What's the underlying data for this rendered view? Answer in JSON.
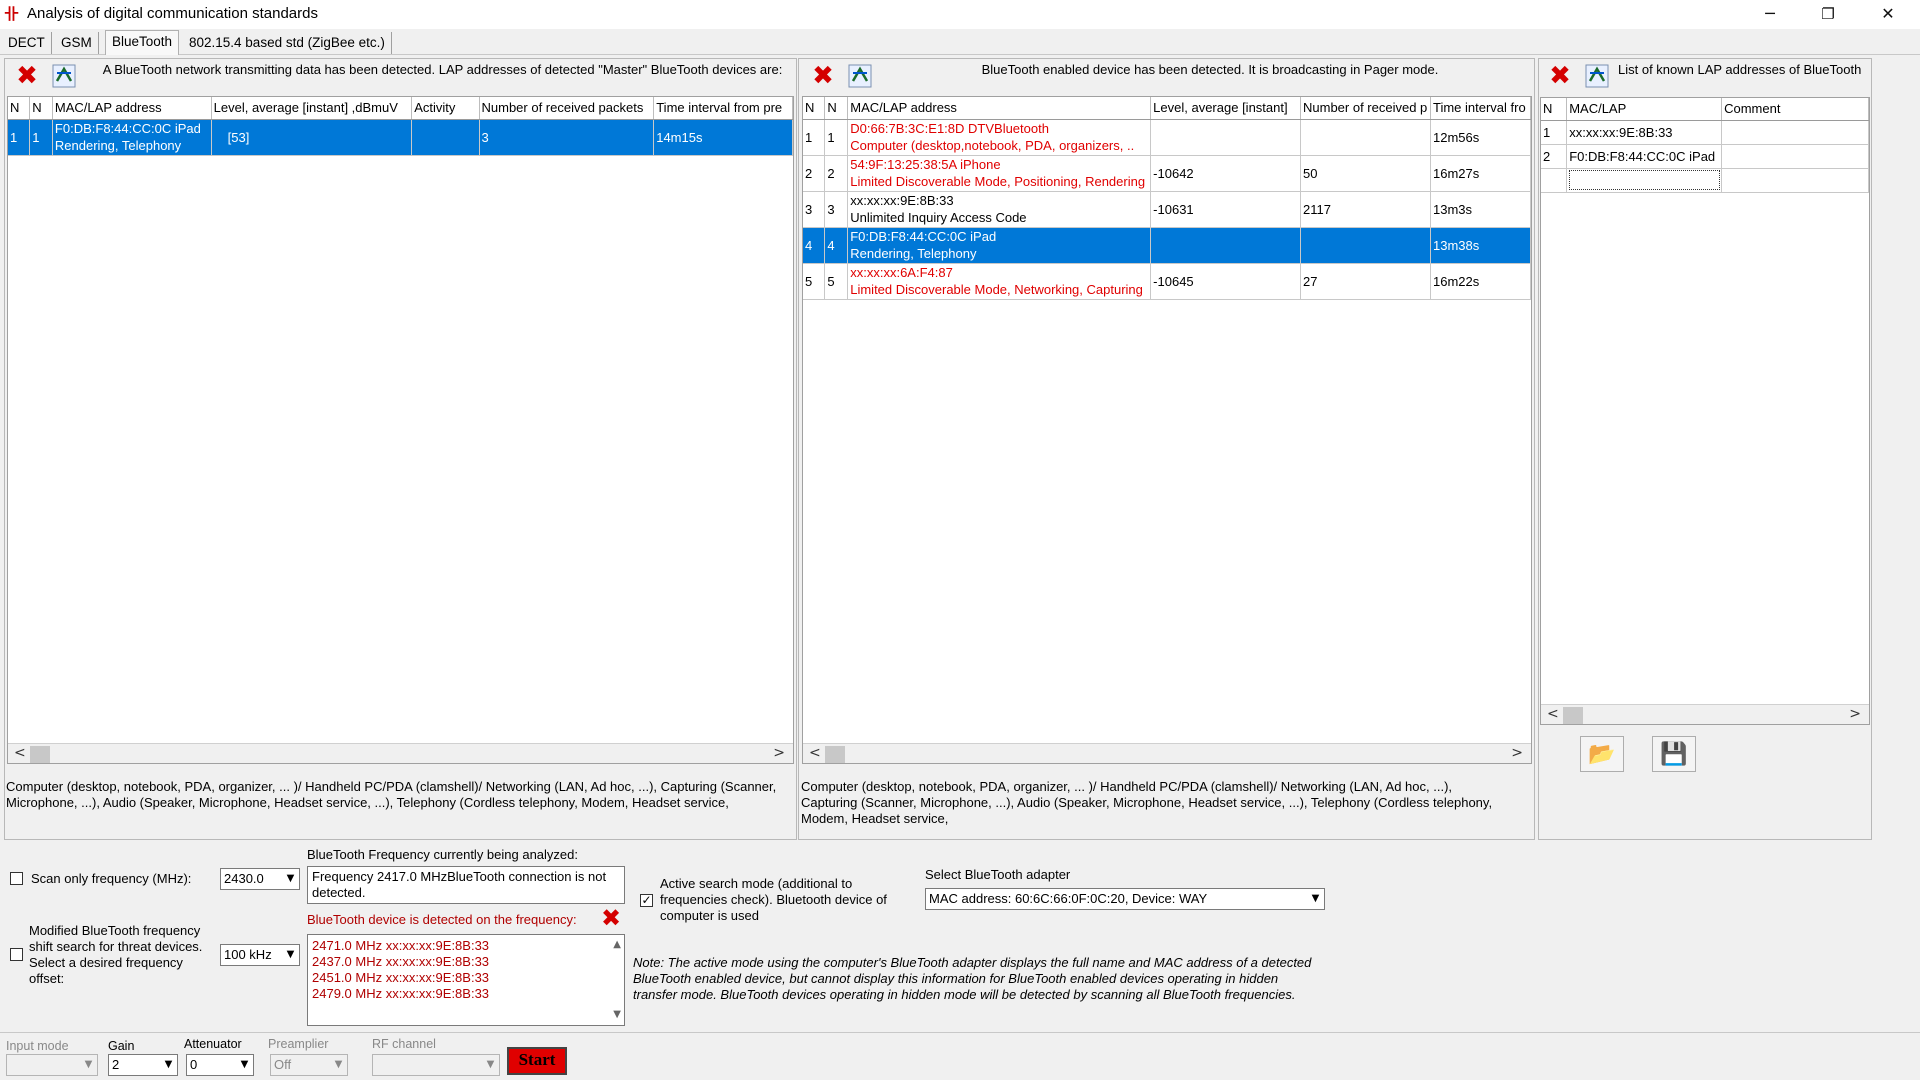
{
  "window": {
    "title": "Analysis of digital communication standards",
    "icon_glyph": "卝",
    "minimize_glyph": "─",
    "restore_glyph": "❐",
    "close_glyph": "✕"
  },
  "tabs": [
    {
      "label": "DECT"
    },
    {
      "label": "GSM"
    },
    {
      "label": "BlueTooth"
    },
    {
      "label": "802.15.4 based std (ZigBee etc.)"
    }
  ],
  "icons": {
    "clear": "✖",
    "scan": "⇄",
    "open": "📂",
    "save": "💾",
    "scroll_left": "<",
    "scroll_right": ">",
    "scroll_up": "▲",
    "scroll_down": "▼",
    "dropdown": "▼",
    "check": "✓"
  },
  "master_panel": {
    "header": "A BlueTooth network transmitting data has been detected. LAP addresses of detected \"Master\" BlueTooth devices are:",
    "columns": [
      "N",
      "N",
      "MAC/LAP address",
      "Level, average [instant] ,dBmuV",
      "Activity",
      "Number of received packets",
      "Time interval from pre"
    ],
    "rows": [
      {
        "n1": "1",
        "n2": "1",
        "mac": "F0:DB:F8:44:CC:0C iPad",
        "desc": "Rendering, Telephony",
        "level": "[53]",
        "activity": "",
        "packets": "3",
        "time": "14m15s"
      }
    ],
    "footer": "Computer (desktop, notebook, PDA, organizer, ... )/ Handheld PC/PDA (clamshell)/ Networking (LAN, Ad hoc, ...), Capturing (Scanner, Microphone, ...), Audio (Speaker, Microphone, Headset service, ...), Telephony (Cordless telephony, Modem, Headset service,"
  },
  "pager_panel": {
    "header": "BlueTooth enabled device has been detected. It is broadcasting in Pager mode.",
    "columns": [
      "N",
      "N",
      "MAC/LAP address",
      "Level, average [instant]",
      "Number of received p",
      "Time interval fro"
    ],
    "rows": [
      {
        "n1": "1",
        "n2": "1",
        "mac": "D0:66:7B:3C:E1:8D DTVBluetooth",
        "desc": "Computer (desktop,notebook, PDA, organizers, ..",
        "level": "",
        "packets": "",
        "time": "12m56s",
        "red": true,
        "selected": false
      },
      {
        "n1": "2",
        "n2": "2",
        "mac": "54:9F:13:25:38:5A iPhone",
        "desc": "Limited Discoverable Mode, Positioning, Rendering",
        "level": "-10642",
        "packets": "50",
        "time": "16m27s",
        "red": true,
        "selected": false
      },
      {
        "n1": "3",
        "n2": "3",
        "mac": "xx:xx:xx:9E:8B:33",
        "desc": "Unlimited Inquiry Access Code",
        "level": "-10631",
        "packets": "2117",
        "time": "13m3s",
        "red": false,
        "selected": false
      },
      {
        "n1": "4",
        "n2": "4",
        "mac": "F0:DB:F8:44:CC:0C iPad",
        "desc": "Rendering, Telephony",
        "level": "",
        "packets": "",
        "time": "13m38s",
        "red": false,
        "selected": true
      },
      {
        "n1": "5",
        "n2": "5",
        "mac": "xx:xx:xx:6A:F4:87",
        "desc": "Limited Discoverable Mode, Networking, Capturing",
        "level": "-10645",
        "packets": "27",
        "time": "16m22s",
        "red": true,
        "selected": false
      }
    ],
    "footer": "Computer (desktop, notebook, PDA, organizer, ... )/ Handheld PC/PDA (clamshell)/ Networking (LAN, Ad hoc, ...), Capturing (Scanner, Microphone, ...), Audio (Speaker, Microphone, Headset service, ...), Telephony (Cordless telephony, Modem, Headset service,"
  },
  "known_panel": {
    "header": "List of known LAP addresses of BlueTooth",
    "columns": [
      "N",
      "MAC/LAP",
      "Comment"
    ],
    "rows": [
      {
        "n": "1",
        "mac": "xx:xx:xx:9E:8B:33",
        "comment": ""
      },
      {
        "n": "2",
        "mac": "F0:DB:F8:44:CC:0C iPad",
        "comment": ""
      }
    ]
  },
  "controls": {
    "scan_only_label": "Scan only frequency (MHz):",
    "scan_only_checked": false,
    "scan_freq_value": "2430.0",
    "modified_shift_label": "Modified BlueTooth frequency shift search for threat devices. Select a desired frequency offset:",
    "modified_shift_checked": false,
    "offset_value": "100 kHz",
    "current_freq_label": "BlueTooth Frequency currently being analyzed:",
    "current_freq_text": "Frequency 2417.0 MHzBlueTooth connection is not detected.",
    "detected_label": "BlueTooth device is detected on the frequency:",
    "detected_list": [
      "2471.0 MHz xx:xx:xx:9E:8B:33",
      "2437.0 MHz xx:xx:xx:9E:8B:33",
      "2451.0 MHz xx:xx:xx:9E:8B:33",
      "2479.0 MHz xx:xx:xx:9E:8B:33"
    ],
    "active_search_label": "Active search mode (additional to frequencies check). Bluetooth device of computer is used",
    "active_search_checked": true,
    "adapter_label": "Select BlueTooth adapter",
    "adapter_value": "MAC address: 60:6C:66:0F:0C:20, Device: WAY",
    "note": "Note: The active mode using the computer's BlueTooth adapter displays the full name and MAC address of a detected BlueTooth enabled device, but cannot display this information for BlueTooth enabled devices operating in hidden transfer mode. BlueTooth devices operating in hidden mode will be detected by scanning all BlueTooth frequencies."
  },
  "bottom": {
    "input_mode_label": "Input mode",
    "input_mode_value": "",
    "gain_label": "Gain",
    "gain_value": "2",
    "attenuator_label": "Attenuator",
    "attenuator_value": "0",
    "preamp_label": "Preamplier",
    "preamp_value": "Off",
    "rf_channel_label": "RF channel",
    "rf_channel_value": "",
    "start_label": "Start"
  }
}
